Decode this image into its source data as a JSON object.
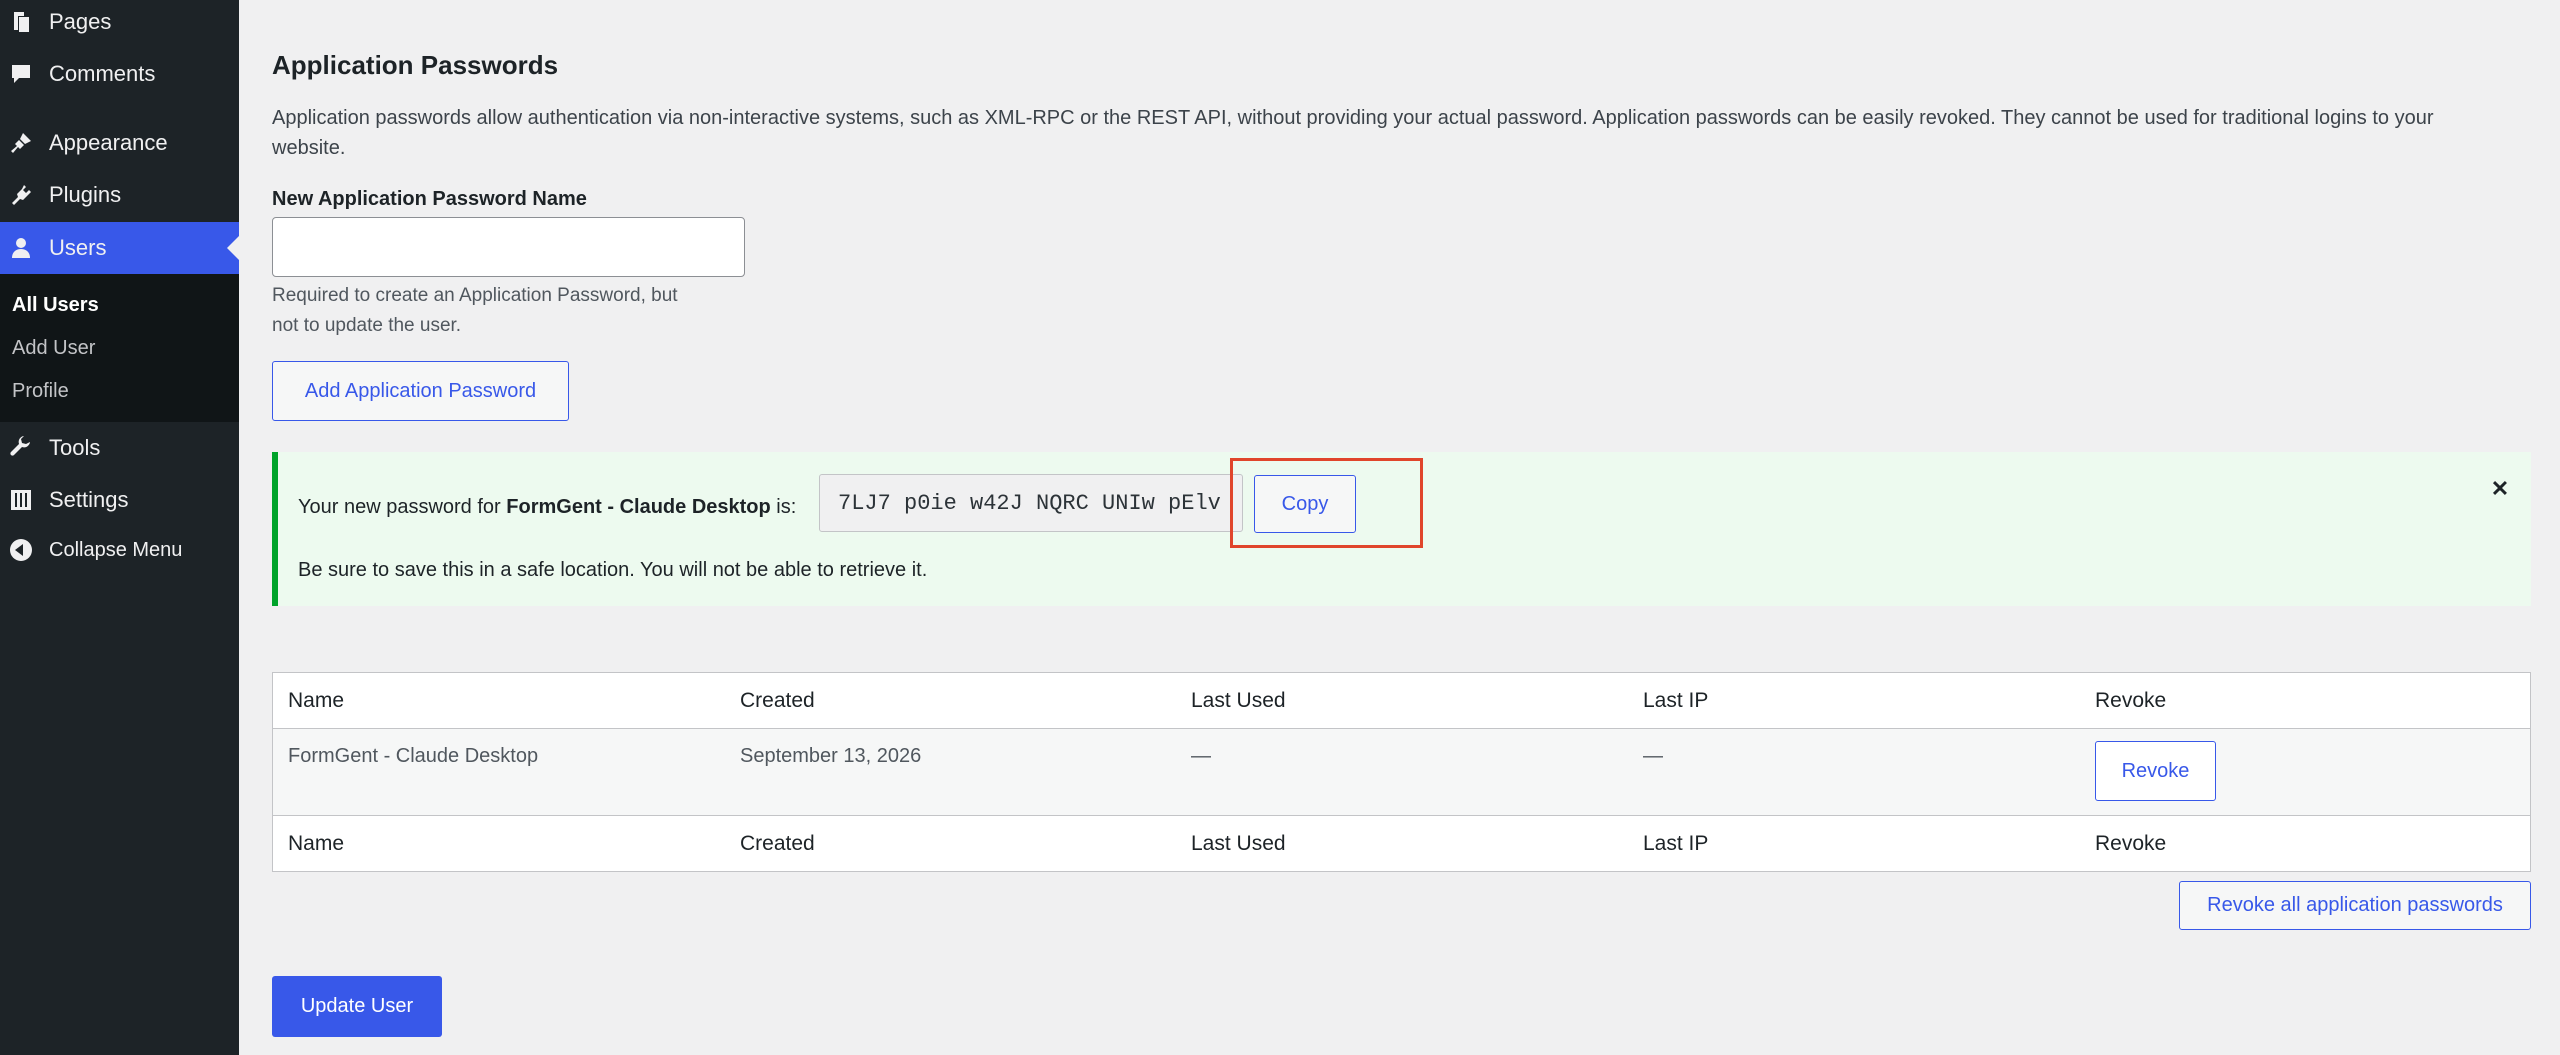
{
  "sidebar": {
    "items": [
      {
        "label": "Pages",
        "icon": "pages-icon"
      },
      {
        "label": "Comments",
        "icon": "comments-icon"
      },
      {
        "label": "Appearance",
        "icon": "appearance-icon"
      },
      {
        "label": "Plugins",
        "icon": "plugins-icon"
      },
      {
        "label": "Users",
        "icon": "users-icon"
      },
      {
        "label": "Tools",
        "icon": "tools-icon"
      },
      {
        "label": "Settings",
        "icon": "settings-icon"
      },
      {
        "label": "Collapse Menu",
        "icon": "collapse-icon"
      }
    ],
    "submenu": [
      "All Users",
      "Add User",
      "Profile"
    ]
  },
  "app_passwords": {
    "title": "Application Passwords",
    "description_line1": "Application passwords allow authentication via non-interactive systems, such as XML-RPC or the REST API, without providing your actual password. Application passwords can be easily revoked. They cannot be used for traditional logins to your",
    "description_line2": "website.",
    "new_name_label": "New Application Password Name",
    "new_name_value": "",
    "help_line1": "Required to create an Application Password, but",
    "help_line2": "not to update the user.",
    "add_button": "Add Application Password"
  },
  "notice": {
    "prefix": "Your new password for ",
    "app_name": "FormGent - Claude Desktop",
    "suffix": " is:",
    "password": "7LJ7 p0ie w42J NQRC UNIw pElv",
    "copy_button": "Copy",
    "save_note": "Be sure to save this in a safe location. You will not be able to retrieve it.",
    "dismiss_glyph": "✕"
  },
  "table": {
    "headers": [
      "Name",
      "Created",
      "Last Used",
      "Last IP",
      "Revoke"
    ],
    "rows": [
      {
        "name": "FormGent - Claude Desktop",
        "created": "September 13, 2026",
        "last_used": "—",
        "last_ip": "—",
        "revoke": "Revoke"
      }
    ],
    "footers": [
      "Name",
      "Created",
      "Last Used",
      "Last IP",
      "Revoke"
    ]
  },
  "revoke_all_button": "Revoke all application passwords",
  "update_user_button": "Update User",
  "colors": {
    "accent": "#3858e9",
    "sidebar": "#1d2327",
    "notice_border": "#00a32a",
    "highlight": "#e0452b"
  }
}
